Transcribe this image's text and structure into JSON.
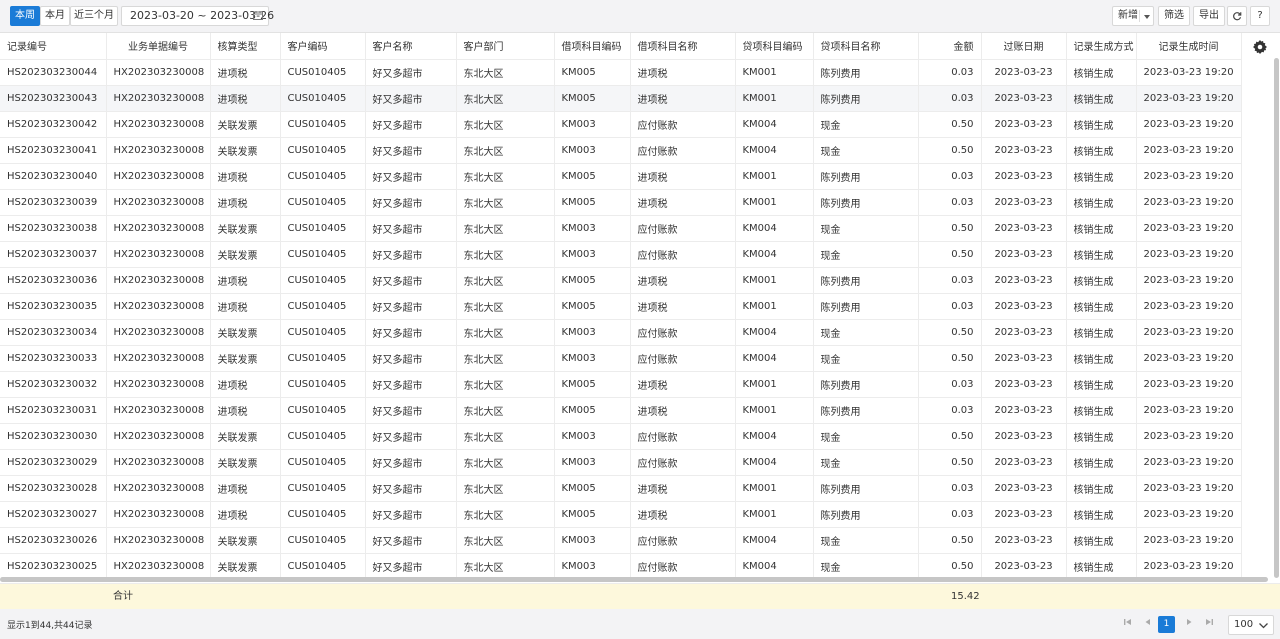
{
  "toolbar": {
    "range_tabs": [
      "本周",
      "本月",
      "近三个月"
    ],
    "date_range": "2023-03-20 ~ 2023-03-26",
    "add_label": "新增",
    "filter_label": "筛选",
    "export_label": "导出",
    "refresh_icon": "refresh-icon",
    "help_label": "?"
  },
  "table": {
    "columns": [
      "记录编号",
      "业务单据编号",
      "核算类型",
      "客户编码",
      "客户名称",
      "客户部门",
      "借项科目编码",
      "借项科目名称",
      "贷项科目编码",
      "贷项科目名称",
      "金额",
      "过账日期",
      "记录生成方式",
      "记录生成时间"
    ],
    "settings_icon": "gear-icon",
    "rows": [
      [
        "HS202303230044",
        "HX202303230008",
        "进项税",
        "CUS010405",
        "好又多超市",
        "东北大区",
        "KM005",
        "进项税",
        "KM001",
        "陈列费用",
        "0.03",
        "2023-03-23",
        "核销生成",
        "2023-03-23 19:20"
      ],
      [
        "HS202303230043",
        "HX202303230008",
        "进项税",
        "CUS010405",
        "好又多超市",
        "东北大区",
        "KM005",
        "进项税",
        "KM001",
        "陈列费用",
        "0.03",
        "2023-03-23",
        "核销生成",
        "2023-03-23 19:20"
      ],
      [
        "HS202303230042",
        "HX202303230008",
        "关联发票",
        "CUS010405",
        "好又多超市",
        "东北大区",
        "KM003",
        "应付账款",
        "KM004",
        "现金",
        "0.50",
        "2023-03-23",
        "核销生成",
        "2023-03-23 19:20"
      ],
      [
        "HS202303230041",
        "HX202303230008",
        "关联发票",
        "CUS010405",
        "好又多超市",
        "东北大区",
        "KM003",
        "应付账款",
        "KM004",
        "现金",
        "0.50",
        "2023-03-23",
        "核销生成",
        "2023-03-23 19:20"
      ],
      [
        "HS202303230040",
        "HX202303230008",
        "进项税",
        "CUS010405",
        "好又多超市",
        "东北大区",
        "KM005",
        "进项税",
        "KM001",
        "陈列费用",
        "0.03",
        "2023-03-23",
        "核销生成",
        "2023-03-23 19:20"
      ],
      [
        "HS202303230039",
        "HX202303230008",
        "进项税",
        "CUS010405",
        "好又多超市",
        "东北大区",
        "KM005",
        "进项税",
        "KM001",
        "陈列费用",
        "0.03",
        "2023-03-23",
        "核销生成",
        "2023-03-23 19:20"
      ],
      [
        "HS202303230038",
        "HX202303230008",
        "关联发票",
        "CUS010405",
        "好又多超市",
        "东北大区",
        "KM003",
        "应付账款",
        "KM004",
        "现金",
        "0.50",
        "2023-03-23",
        "核销生成",
        "2023-03-23 19:20"
      ],
      [
        "HS202303230037",
        "HX202303230008",
        "关联发票",
        "CUS010405",
        "好又多超市",
        "东北大区",
        "KM003",
        "应付账款",
        "KM004",
        "现金",
        "0.50",
        "2023-03-23",
        "核销生成",
        "2023-03-23 19:20"
      ],
      [
        "HS202303230036",
        "HX202303230008",
        "进项税",
        "CUS010405",
        "好又多超市",
        "东北大区",
        "KM005",
        "进项税",
        "KM001",
        "陈列费用",
        "0.03",
        "2023-03-23",
        "核销生成",
        "2023-03-23 19:20"
      ],
      [
        "HS202303230035",
        "HX202303230008",
        "进项税",
        "CUS010405",
        "好又多超市",
        "东北大区",
        "KM005",
        "进项税",
        "KM001",
        "陈列费用",
        "0.03",
        "2023-03-23",
        "核销生成",
        "2023-03-23 19:20"
      ],
      [
        "HS202303230034",
        "HX202303230008",
        "关联发票",
        "CUS010405",
        "好又多超市",
        "东北大区",
        "KM003",
        "应付账款",
        "KM004",
        "现金",
        "0.50",
        "2023-03-23",
        "核销生成",
        "2023-03-23 19:20"
      ],
      [
        "HS202303230033",
        "HX202303230008",
        "关联发票",
        "CUS010405",
        "好又多超市",
        "东北大区",
        "KM003",
        "应付账款",
        "KM004",
        "现金",
        "0.50",
        "2023-03-23",
        "核销生成",
        "2023-03-23 19:20"
      ],
      [
        "HS202303230032",
        "HX202303230008",
        "进项税",
        "CUS010405",
        "好又多超市",
        "东北大区",
        "KM005",
        "进项税",
        "KM001",
        "陈列费用",
        "0.03",
        "2023-03-23",
        "核销生成",
        "2023-03-23 19:20"
      ],
      [
        "HS202303230031",
        "HX202303230008",
        "进项税",
        "CUS010405",
        "好又多超市",
        "东北大区",
        "KM005",
        "进项税",
        "KM001",
        "陈列费用",
        "0.03",
        "2023-03-23",
        "核销生成",
        "2023-03-23 19:20"
      ],
      [
        "HS202303230030",
        "HX202303230008",
        "关联发票",
        "CUS010405",
        "好又多超市",
        "东北大区",
        "KM003",
        "应付账款",
        "KM004",
        "现金",
        "0.50",
        "2023-03-23",
        "核销生成",
        "2023-03-23 19:20"
      ],
      [
        "HS202303230029",
        "HX202303230008",
        "关联发票",
        "CUS010405",
        "好又多超市",
        "东北大区",
        "KM003",
        "应付账款",
        "KM004",
        "现金",
        "0.50",
        "2023-03-23",
        "核销生成",
        "2023-03-23 19:20"
      ],
      [
        "HS202303230028",
        "HX202303230008",
        "进项税",
        "CUS010405",
        "好又多超市",
        "东北大区",
        "KM005",
        "进项税",
        "KM001",
        "陈列费用",
        "0.03",
        "2023-03-23",
        "核销生成",
        "2023-03-23 19:20"
      ],
      [
        "HS202303230027",
        "HX202303230008",
        "进项税",
        "CUS010405",
        "好又多超市",
        "东北大区",
        "KM005",
        "进项税",
        "KM001",
        "陈列费用",
        "0.03",
        "2023-03-23",
        "核销生成",
        "2023-03-23 19:20"
      ],
      [
        "HS202303230026",
        "HX202303230008",
        "关联发票",
        "CUS010405",
        "好又多超市",
        "东北大区",
        "KM003",
        "应付账款",
        "KM004",
        "现金",
        "0.50",
        "2023-03-23",
        "核销生成",
        "2023-03-23 19:20"
      ],
      [
        "HS202303230025",
        "HX202303230008",
        "关联发票",
        "CUS010405",
        "好又多超市",
        "东北大区",
        "KM003",
        "应付账款",
        "KM004",
        "现金",
        "0.50",
        "2023-03-23",
        "核销生成",
        "2023-03-23 19:20"
      ]
    ],
    "selected_row": 1
  },
  "summary": {
    "label": "合计",
    "amount_total": "15.42"
  },
  "footer": {
    "status": "显示1到44,共44记录",
    "current_page": "1",
    "page_size": "100"
  }
}
